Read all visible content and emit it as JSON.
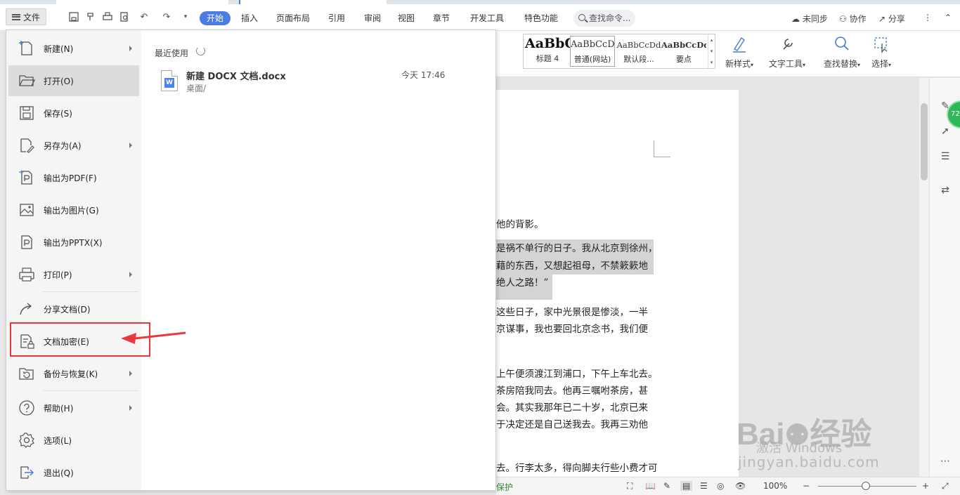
{
  "quick_access": {
    "file_label": "文件"
  },
  "tabs": [
    {
      "label": "开始",
      "active": true
    },
    {
      "label": "插入"
    },
    {
      "label": "页面布局"
    },
    {
      "label": "引用"
    },
    {
      "label": "审阅"
    },
    {
      "label": "视图"
    },
    {
      "label": "章节"
    },
    {
      "label": "开发工具"
    },
    {
      "label": "特色功能"
    }
  ],
  "search_commands": "查找命令...",
  "top_right": {
    "unsync": "未同步",
    "collaborate": "协作",
    "share": "分享"
  },
  "ribbon": {
    "styles": [
      {
        "preview": "AaBbC",
        "label": "标题 4"
      },
      {
        "preview": "AaBbCcD",
        "label": "普通(网站)",
        "selected": true
      },
      {
        "preview": "AaBbCcDd",
        "label": "默认段..."
      },
      {
        "preview": "AaBbCcDd",
        "label": "要点"
      }
    ],
    "new_style": "新样式",
    "text_tools": "文字工具",
    "find_replace": "查找替换",
    "select": "选择"
  },
  "file_menu": {
    "items": [
      {
        "label": "新建(N)",
        "icon": "new-doc-icon",
        "submenu": true
      },
      {
        "label": "打开(O)",
        "icon": "folder-open-icon",
        "active": true
      },
      {
        "label": "保存(S)",
        "icon": "save-icon"
      },
      {
        "label": "另存为(A)",
        "icon": "save-as-icon",
        "submenu": true
      },
      {
        "label": "输出为PDF(F)",
        "icon": "pdf-icon"
      },
      {
        "label": "输出为图片(G)",
        "icon": "image-icon"
      },
      {
        "label": "输出为PPTX(X)",
        "icon": "pptx-icon"
      },
      {
        "label": "打印(P)",
        "icon": "printer-icon",
        "submenu": true
      },
      {
        "label": "分享文档(D)",
        "icon": "share-icon"
      },
      {
        "label": "文档加密(E)",
        "icon": "encrypt-doc-icon"
      },
      {
        "label": "备份与恢复(K)",
        "icon": "backup-icon",
        "submenu": true
      },
      {
        "label": "帮助(H)",
        "icon": "help-icon",
        "submenu": true
      },
      {
        "label": "选项(L)",
        "icon": "gear-icon"
      },
      {
        "label": "退出(Q)",
        "icon": "exit-icon"
      }
    ],
    "recent": {
      "title": "最近使用",
      "files": [
        {
          "name": "新建 DOCX 文档.docx",
          "path": "桌面/",
          "time": "今天 17:46"
        }
      ]
    }
  },
  "document": {
    "lines": [
      "他的背影。",
      "是祸不单行的日子。我从北京到徐州，",
      "藉的东西，又想起祖母，不禁簌簌地",
      "绝人之路！”",
      "这些日子，家中光景很是惨淡，一半",
      "京谋事，我也要回北京念书，我们便",
      "上午便须渡江到浦口，下午上车北去。",
      "茶房陪我同去。他再三嘱咐茶房，甚",
      "会。其实我那年已二十岁，北京已来",
      "于决定还是自己送我去。我再三劝他",
      "去。行李太多，得向脚夫行些小费才可"
    ]
  },
  "status_bar": {
    "protect": "保护",
    "zoom": "100%"
  },
  "watermark": {
    "activate": "激活 Windows",
    "baidu": "Bai",
    "baidu2": "经验",
    "site": "jingyan.baidu.com"
  },
  "colors": {
    "accent": "#4b7be5",
    "annotation": "#e8383d"
  }
}
